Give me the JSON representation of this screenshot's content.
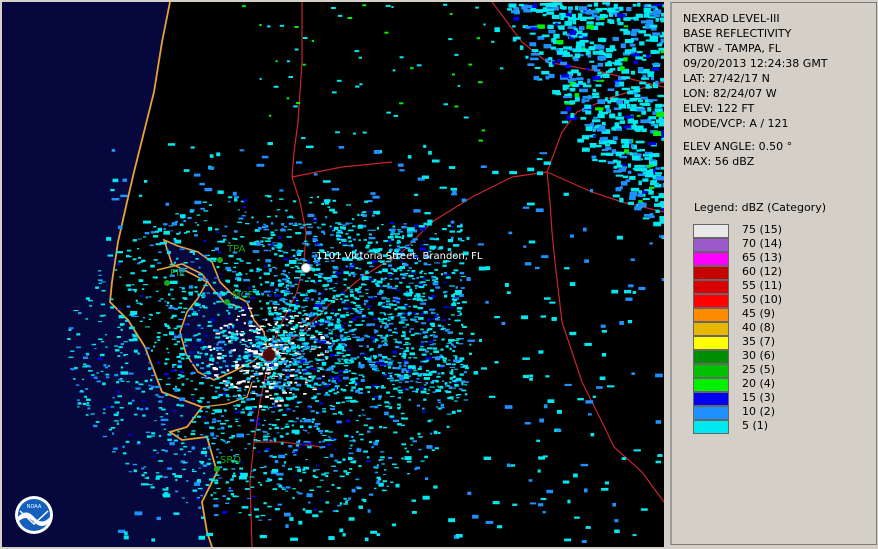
{
  "colors": {
    "gulf": "#06083d",
    "land": "#000000",
    "coastline": "#e8a23a",
    "road": "#c8262a",
    "station_label": "#1ca81c"
  },
  "map": {
    "address_label": "1101 Victoria Street, Brandon, FL",
    "stations": [
      "TPA",
      "PIE",
      "MCF",
      "SRQ"
    ],
    "logo_icon": "noaa-logo-icon"
  },
  "info": {
    "product": "NEXRAD LEVEL-III",
    "type": "BASE REFLECTIVITY",
    "station": "KTBW - TAMPA, FL",
    "datetime": "09/20/2013 12:24:38 GMT",
    "lat": "LAT: 27/42/17 N",
    "lon": "LON: 82/24/07 W",
    "elev": "ELEV: 122 FT",
    "mode": "MODE/VCP: A / 121",
    "elev_angle": "ELEV ANGLE: 0.50 °",
    "max": "MAX: 56 dBZ"
  },
  "legend": {
    "title": "Legend: dBZ (Category)",
    "items": [
      {
        "label": "75  (15)",
        "color": "#e8e8e8"
      },
      {
        "label": "70  (14)",
        "color": "#9b59c9"
      },
      {
        "label": "65  (13)",
        "color": "#ff00ff"
      },
      {
        "label": "60  (12)",
        "color": "#c40000"
      },
      {
        "label": "55  (11)",
        "color": "#d80000"
      },
      {
        "label": "50  (10)",
        "color": "#ff0000"
      },
      {
        "label": "45  (9)",
        "color": "#ff8c00"
      },
      {
        "label": "40  (8)",
        "color": "#e8b800"
      },
      {
        "label": "35  (7)",
        "color": "#ffff00"
      },
      {
        "label": "30  (6)",
        "color": "#008c00"
      },
      {
        "label": "25  (5)",
        "color": "#00c000"
      },
      {
        "label": "20  (4)",
        "color": "#00f000"
      },
      {
        "label": "15  (3)",
        "color": "#0000ee"
      },
      {
        "label": "10  (2)",
        "color": "#1e90ff"
      },
      {
        "label": "5  (1)",
        "color": "#00e8f0"
      }
    ]
  }
}
